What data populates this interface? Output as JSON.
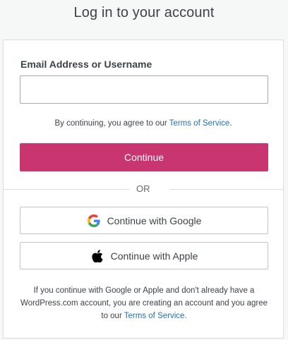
{
  "page": {
    "title": "Log in to your account"
  },
  "form": {
    "email_label": "Email Address or Username",
    "email_value": "",
    "email_placeholder": "",
    "tos_prefix": "By continuing, you agree to our ",
    "tos_link": "Terms of Service",
    "tos_suffix": ".",
    "continue_label": "Continue"
  },
  "divider": {
    "text": "OR"
  },
  "social": {
    "google_label": "Continue with Google",
    "google_icon": "google-logo-icon",
    "apple_label": "Continue with Apple",
    "apple_icon": "apple-logo-icon"
  },
  "footer": {
    "note_prefix": "If you continue with Google or Apple and don't already have a WordPress.com account, you are creating an account and you agree to our ",
    "note_link": "Terms of Service",
    "note_suffix": "."
  },
  "colors": {
    "primary": "#c9356e",
    "link": "#2271b1",
    "background": "#f6f7f7",
    "card": "#ffffff"
  }
}
